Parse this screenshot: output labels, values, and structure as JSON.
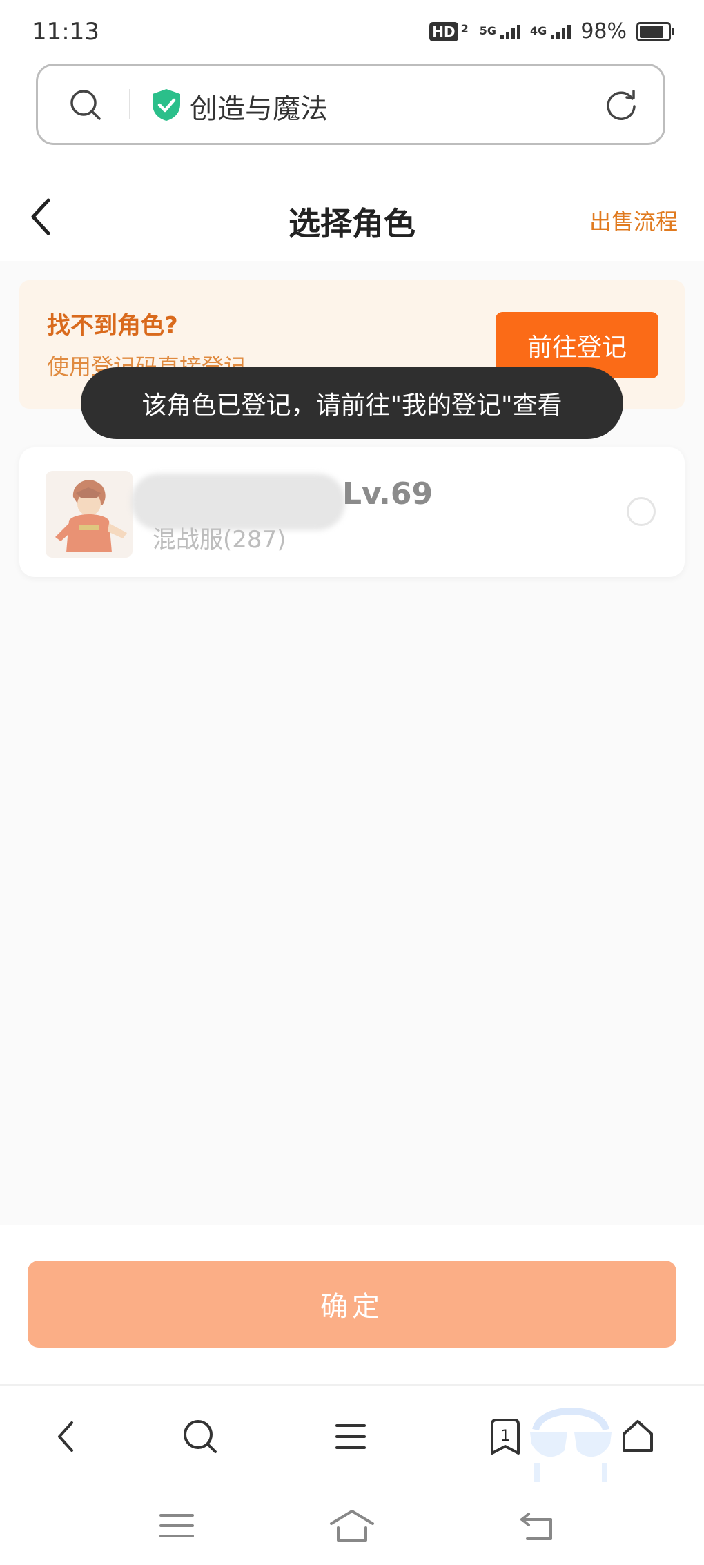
{
  "status_bar": {
    "time": "11:13",
    "hd_label": "HD",
    "hd_sim": "2",
    "sim1_network": "5G",
    "sim2_network": "4G",
    "battery": "98%"
  },
  "browser_url": {
    "title": "创造与魔法"
  },
  "header": {
    "title": "选择角色",
    "sell_process_link": "出售流程"
  },
  "notice": {
    "title": "找不到角色?",
    "subtitle": "使用登记码直接登记",
    "button_label": "前往登记"
  },
  "toast": {
    "message": "该角色已登记，请前往\"我的登记\"查看"
  },
  "role_card": {
    "level": "Lv.69",
    "server": "混战服(287)",
    "selected": false
  },
  "confirm_button": {
    "label": "确定"
  },
  "browser_toolbar": {
    "tab_count": "1"
  },
  "colors": {
    "accent": "#fb6b17",
    "accent_text": "#e07a1f",
    "confirm_disabled": "#fbae86",
    "notice_bg": "#fdf4ea",
    "toast_bg": "#2f2f2f"
  },
  "icons": [
    "search-icon",
    "shield-check-icon",
    "refresh-icon",
    "back-arrow-icon",
    "nav-back-icon",
    "nav-search-icon",
    "menu-icon",
    "tabs-icon",
    "home-icon",
    "gesture-menu-icon",
    "gesture-home-icon",
    "gesture-back-icon"
  ]
}
